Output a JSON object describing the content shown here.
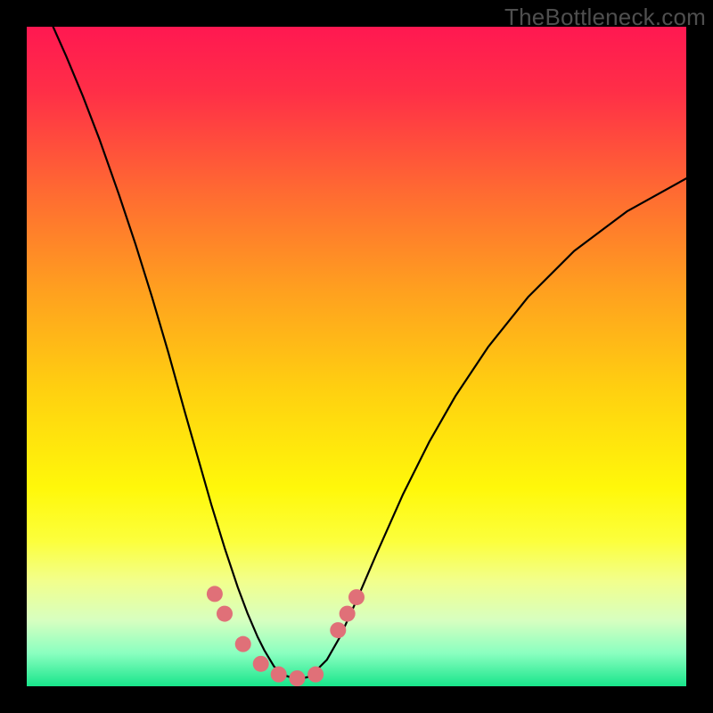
{
  "watermark": "TheBottleneck.com",
  "chart_data": {
    "type": "line",
    "title": "",
    "xlabel": "",
    "ylabel": "",
    "xlim": [
      0,
      1
    ],
    "ylim": [
      0,
      1
    ],
    "gradient_stops": [
      {
        "pos": 0.0,
        "color": "#ff1851"
      },
      {
        "pos": 0.1,
        "color": "#ff2f47"
      },
      {
        "pos": 0.25,
        "color": "#ff6a32"
      },
      {
        "pos": 0.4,
        "color": "#ffa01f"
      },
      {
        "pos": 0.55,
        "color": "#ffd010"
      },
      {
        "pos": 0.7,
        "color": "#fff80a"
      },
      {
        "pos": 0.78,
        "color": "#fcff3c"
      },
      {
        "pos": 0.84,
        "color": "#f2ff8c"
      },
      {
        "pos": 0.9,
        "color": "#d7ffc0"
      },
      {
        "pos": 0.95,
        "color": "#8affc0"
      },
      {
        "pos": 1.0,
        "color": "#18e58b"
      }
    ],
    "series": [
      {
        "name": "bottleneck-curve",
        "stroke": "#000000",
        "stroke_width": 2.2,
        "x": [
          0.04,
          0.06,
          0.085,
          0.11,
          0.14,
          0.165,
          0.19,
          0.215,
          0.24,
          0.26,
          0.28,
          0.3,
          0.32,
          0.335,
          0.35,
          0.36,
          0.375,
          0.39,
          0.41,
          0.43,
          0.455,
          0.475,
          0.5,
          0.53,
          0.57,
          0.61,
          0.65,
          0.7,
          0.76,
          0.83,
          0.91,
          1.0
        ],
        "y": [
          1.0,
          0.955,
          0.895,
          0.83,
          0.745,
          0.67,
          0.59,
          0.505,
          0.415,
          0.345,
          0.275,
          0.21,
          0.15,
          0.11,
          0.075,
          0.055,
          0.03,
          0.017,
          0.01,
          0.015,
          0.04,
          0.075,
          0.13,
          0.2,
          0.29,
          0.37,
          0.44,
          0.515,
          0.59,
          0.66,
          0.72,
          0.77
        ]
      }
    ],
    "markers": [
      {
        "name": "pink-dots-left",
        "color": "#e07078",
        "radius": 9,
        "points": [
          {
            "x": 0.285,
            "y": 0.14
          },
          {
            "x": 0.3,
            "y": 0.11
          },
          {
            "x": 0.328,
            "y": 0.064
          },
          {
            "x": 0.355,
            "y": 0.034
          },
          {
            "x": 0.382,
            "y": 0.018
          },
          {
            "x": 0.41,
            "y": 0.012
          },
          {
            "x": 0.438,
            "y": 0.018
          }
        ]
      },
      {
        "name": "pink-dots-right",
        "color": "#e07078",
        "radius": 9,
        "points": [
          {
            "x": 0.472,
            "y": 0.085
          },
          {
            "x": 0.486,
            "y": 0.11
          },
          {
            "x": 0.5,
            "y": 0.135
          }
        ]
      }
    ]
  }
}
